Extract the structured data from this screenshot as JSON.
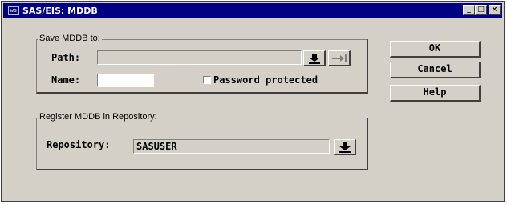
{
  "window": {
    "title": "SAS/EIS: MDDB",
    "sys_icon": "ws",
    "minimize": "_",
    "maximize": "□",
    "close": "×"
  },
  "save_group": {
    "legend": "Save MDDB to:",
    "path_label": "Path:",
    "path_value": "",
    "name_label": "Name:",
    "name_value": "",
    "password_label": "Password protected",
    "password_checked": false
  },
  "register_group": {
    "legend": "Register MDDB in Repository:",
    "repository_label": "Repository:",
    "repository_value": "SASUSER"
  },
  "buttons": {
    "ok": "OK",
    "cancel": "Cancel",
    "help": "Help"
  },
  "icons": {
    "path_download": "down-arrow-icon",
    "path_arrow": "right-arrow-icon",
    "repository_download": "down-arrow-icon"
  }
}
